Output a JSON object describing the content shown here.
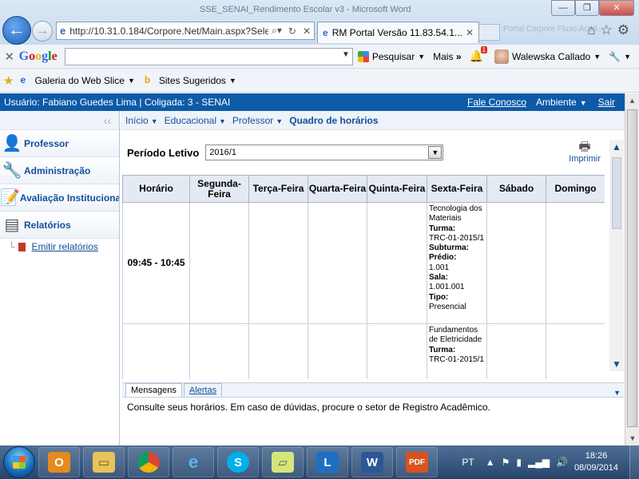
{
  "browser": {
    "window_title": "SSE_SENAI_Rendimento Escolar v3 - Microsoft Word",
    "address_url": "http://10.31.0.184/Corpore.Net/Main.aspx?Sele",
    "tab_title": "RM Portal Versão 11.83.54.1...",
    "ghost_tabs": "Portal Corpore    Fluxo Acad..."
  },
  "google_toolbar": {
    "logo": "Google",
    "search_label": "Pesquisar",
    "more_label": "Mais",
    "notification_count": "1",
    "user_name": "Walewska Callado"
  },
  "favorites": {
    "items": [
      {
        "label": "Galeria do Web Slice"
      },
      {
        "label": "Sites Sugeridos"
      }
    ]
  },
  "header": {
    "user_info": "Usuário: Fabiano Guedes Lima  |  Coligada: 3 - SENAI",
    "contact_label": "Fale Conosco",
    "environment_label": "Ambiente",
    "logout_label": "Sair"
  },
  "sidebar": {
    "items": [
      {
        "label": "Professor"
      },
      {
        "label": "Administração"
      },
      {
        "label": "Avaliação Institucional"
      },
      {
        "label": "Relatórios"
      }
    ],
    "sub_items": [
      {
        "label": "Emitir relatórios"
      }
    ]
  },
  "breadcrumb": {
    "items": [
      "Início",
      "Educacional",
      "Professor"
    ],
    "current": "Quadro de horários"
  },
  "period": {
    "label": "Período Letivo",
    "selected": "2016/1"
  },
  "print_label": "Imprimir",
  "schedule": {
    "columns": [
      "Horário",
      "Segunda-Feira",
      "Terça-Feira",
      "Quarta-Feira",
      "Quinta-Feira",
      "Sexta-Feira",
      "Sábado",
      "Domingo"
    ],
    "rows": [
      {
        "time": "09:45 - 10:45",
        "friday": {
          "subject": "Tecnologia dos Materiais",
          "turma_label": "Turma:",
          "turma": "TRC-01-2015/1",
          "subturma_label": "Subturma:",
          "predio_label": "Prédio:",
          "predio": "1.001",
          "sala_label": "Sala:",
          "sala": "1.001.001",
          "tipo_label": "Tipo:",
          "tipo": "Presencial"
        }
      },
      {
        "time": "",
        "friday": {
          "subject": "Fundamentos de Eletricidade",
          "turma_label": "Turma:",
          "turma": "TRC-01-2015/1"
        }
      }
    ]
  },
  "messages": {
    "tab_messages": "Mensagens",
    "tab_alerts": "Alertas",
    "body": "Consulte seus horários. Em caso de dúvidas, procure o setor de Registro Acadêmico."
  },
  "taskbar": {
    "language": "PT",
    "time": "18:26",
    "date": "08/09/2014"
  }
}
